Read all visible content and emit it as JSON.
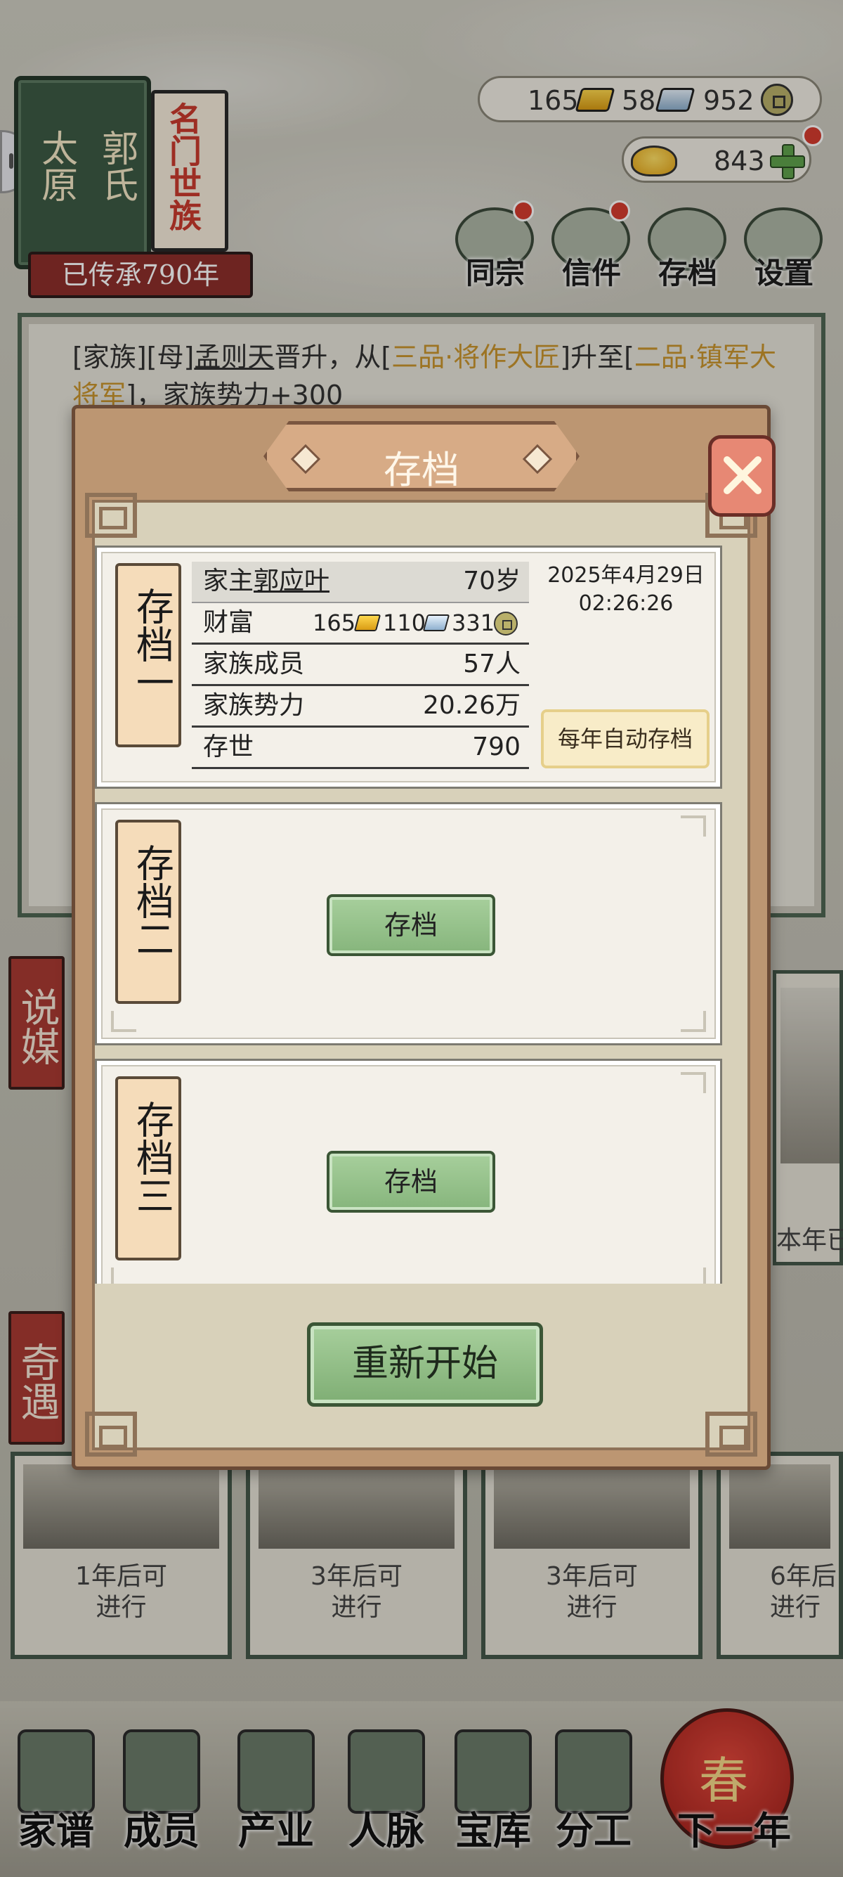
{
  "family": {
    "name_line1": "太原",
    "name_line2": "郭氏",
    "rank_banner": "名门世族",
    "heritage": "已传承790年"
  },
  "currency": {
    "gold_bars": "165",
    "silver_bars": "58",
    "coins": "952",
    "yuanbao": "843"
  },
  "top_menu": [
    {
      "label": "同宗",
      "icon": "clan-book-icon",
      "has_alert": true
    },
    {
      "label": "信件",
      "icon": "letter-icon",
      "has_alert": true
    },
    {
      "label": "存档",
      "icon": "save-scroll-icon",
      "has_alert": false
    },
    {
      "label": "设置",
      "icon": "gear-icon",
      "has_alert": false
    }
  ],
  "news": {
    "t1": "[家族][母]",
    "person": "孟则天",
    "t2": "晋升，从[",
    "rank_from": "三品·将作大匠",
    "t3": "]升至[",
    "rank_to": "二品·镇军大将军",
    "t4": "]，家族势力+300"
  },
  "side_tags": [
    "说媒",
    "奇遇"
  ],
  "activity_cards": [
    {
      "line1": "1年后可",
      "line2": "进行"
    },
    {
      "line1": "3年后可",
      "line2": "进行"
    },
    {
      "line1": "3年后可",
      "line2": "进行"
    },
    {
      "line1": "6年后",
      "line2": "进行"
    }
  ],
  "right_peek_text": "本年已",
  "bottom_nav": [
    {
      "label": "家谱",
      "icon": "genealogy-book-icon"
    },
    {
      "label": "成员",
      "icon": "member-portrait-icon"
    },
    {
      "label": "产业",
      "icon": "pavilion-icon"
    },
    {
      "label": "人脉",
      "icon": "network-icon"
    },
    {
      "label": "宝库",
      "icon": "treasure-box-icon"
    },
    {
      "label": "分工",
      "icon": "scroll-icon"
    },
    {
      "label": "下一年",
      "icon": "spring-lantern-icon",
      "lantern_char": "春"
    }
  ],
  "modal": {
    "title": "存档",
    "restart_label": "重新开始",
    "slots": [
      {
        "tag": "存档一",
        "filled": true,
        "head_label": "家主",
        "head_name": "郭应叶",
        "head_age": "70岁",
        "wealth_label": "财富",
        "wealth_gold": "165",
        "wealth_silver": "110",
        "wealth_coins": "331",
        "members_label": "家族成员",
        "members_value": "57人",
        "influence_label": "家族势力",
        "influence_value": "20.26万",
        "generations_label": "存世",
        "generations_value": "790",
        "date": "2025年4月29日",
        "time": "02:26:26",
        "auto_save_label": "每年自动存档"
      },
      {
        "tag": "存档二",
        "filled": false,
        "save_label": "存档"
      },
      {
        "tag": "存档三",
        "filled": false,
        "save_label": "存档"
      }
    ]
  },
  "colors": {
    "modal_frame": "#bc9672",
    "save_green": "#86b57c",
    "highlight_gold": "#c9952e",
    "tag_red": "#a93a33"
  }
}
